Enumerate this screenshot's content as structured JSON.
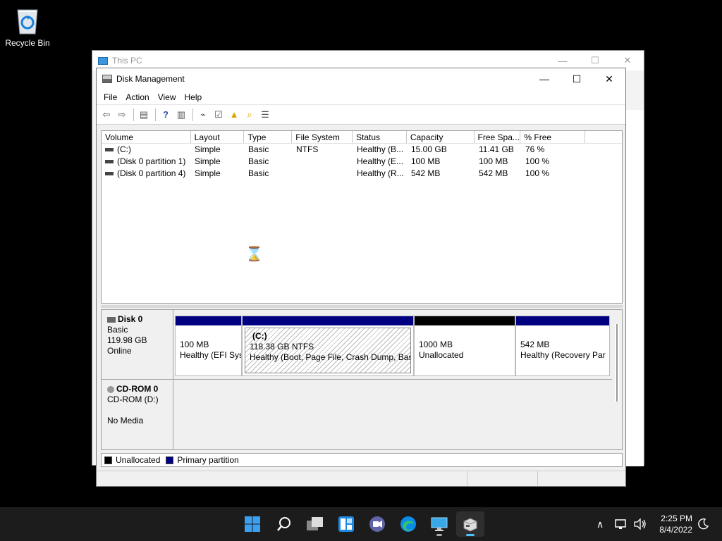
{
  "desktop": {
    "recycle_bin_label": "Recycle Bin"
  },
  "background_window": {
    "title": "This PC"
  },
  "window": {
    "title": "Disk Management",
    "menu": [
      "File",
      "Action",
      "View",
      "Help"
    ]
  },
  "volume_table": {
    "columns": [
      "Volume",
      "Layout",
      "Type",
      "File System",
      "Status",
      "Capacity",
      "Free Spa...",
      "% Free"
    ],
    "rows": [
      [
        "(C:)",
        "Simple",
        "Basic",
        "NTFS",
        "Healthy (B...",
        "15.00 GB",
        "11.41 GB",
        "76 %"
      ],
      [
        "(Disk 0 partition 1)",
        "Simple",
        "Basic",
        "",
        "Healthy (E...",
        "100 MB",
        "100 MB",
        "100 %"
      ],
      [
        "(Disk 0 partition 4)",
        "Simple",
        "Basic",
        "",
        "Healthy (R...",
        "542 MB",
        "542 MB",
        "100 %"
      ]
    ]
  },
  "disk0": {
    "name": "Disk 0",
    "type": "Basic",
    "size": "119.98 GB",
    "state": "Online",
    "partitions": [
      {
        "title": "",
        "size": "100 MB",
        "status": "Healthy (EFI Sys"
      },
      {
        "title": "(C:)",
        "size": "118.38 GB NTFS",
        "status": "Healthy (Boot, Page File, Crash Dump, Basic"
      },
      {
        "title": "",
        "size": "1000 MB",
        "status": "Unallocated"
      },
      {
        "title": "",
        "size": "542 MB",
        "status": "Healthy (Recovery Par"
      }
    ]
  },
  "cdrom0": {
    "name": "CD-ROM 0",
    "label": "CD-ROM (D:)",
    "media": "No Media"
  },
  "legend": {
    "unallocated": "Unallocated",
    "primary": "Primary partition"
  },
  "colors": {
    "primary": "#000080",
    "unallocated": "#000000"
  },
  "taskbar": {
    "time": "2:25 PM",
    "date": "8/4/2022"
  }
}
